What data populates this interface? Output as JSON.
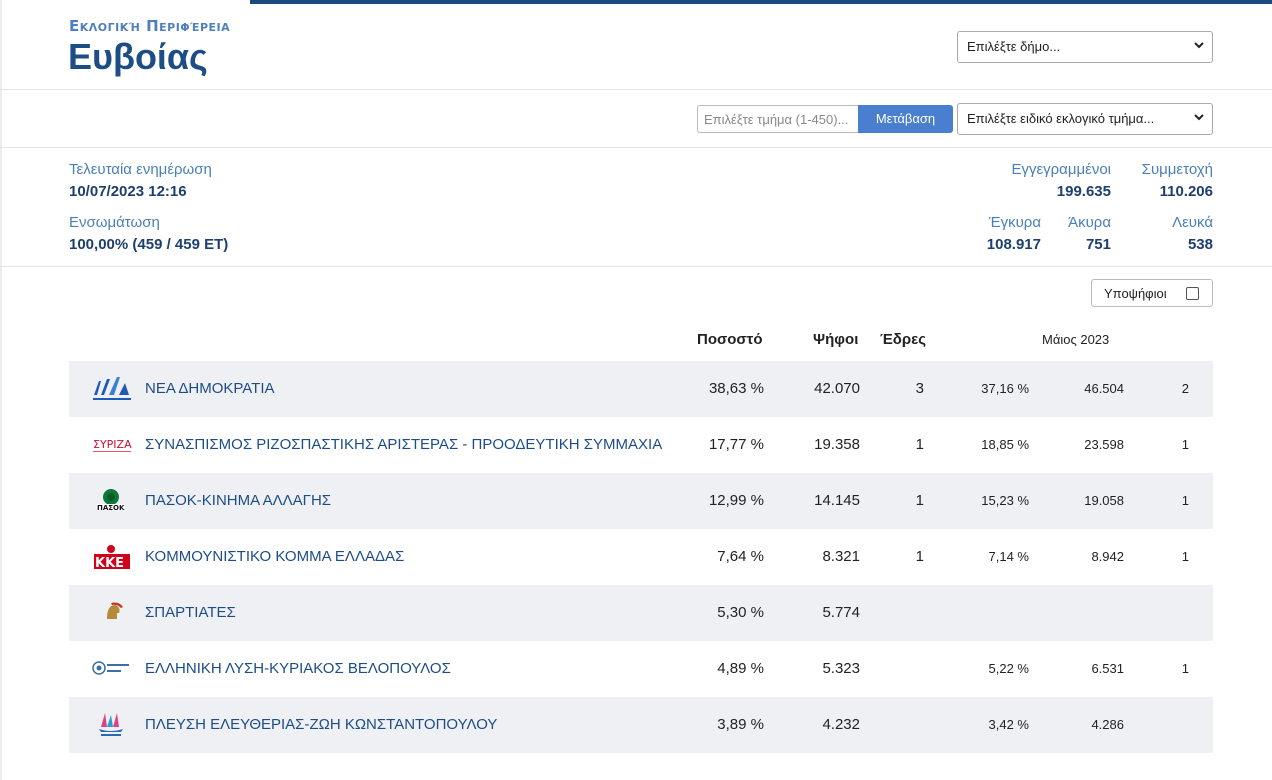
{
  "header": {
    "region_label": "Εκλογική Περιφέρεια",
    "region_name": "Ευβοίας",
    "municipality_select": "Επιλέξτε δήμο...",
    "section_input_placeholder": "Επιλέξτε τμήμα (1-450)...",
    "go_button": "Μετάβαση",
    "special_section_select": "Επιλέξτε ειδικό εκλογικό τμήμα..."
  },
  "stats": {
    "last_update_label": "Τελευταία ενημέρωση",
    "last_update_value": "10/07/2023 12:16",
    "integration_label": "Ενσωμάτωση",
    "integration_value": "100,00% (459 / 459 ΕΤ)",
    "registered_label": "Εγγεγραμμένοι",
    "registered_value": "199.635",
    "turnout_label": "Συμμετοχή",
    "turnout_value": "110.206",
    "valid_label": "Έγκυρα",
    "valid_value": "108.917",
    "invalid_label": "Άκυρα",
    "invalid_value": "751",
    "blank_label": "Λευκά",
    "blank_value": "538"
  },
  "candidates_toggle": "Υποψήφιοι",
  "table": {
    "headers": {
      "percent": "Ποσοστό",
      "votes": "Ψήφοι",
      "seats": "Έδρες",
      "prev": "Μάιος 2023"
    },
    "rows": [
      {
        "name": "ΝΕΑ ΔΗΜΟΚΡΑΤΙΑ",
        "logo": "nd-logo-icon",
        "pct": "38,63 %",
        "votes": "42.070",
        "seats": "3",
        "prev_pct": "37,16 %",
        "prev_votes": "46.504",
        "prev_seats": "2"
      },
      {
        "name": "ΣΥΝΑΣΠΙΣΜΟΣ ΡΙΖΟΣΠΑΣΤΙΚΗΣ ΑΡΙΣΤΕΡΑΣ - ΠΡΟΟΔΕΥΤΙΚΗ ΣΥΜΜΑΧΙΑ",
        "logo": "syriza-logo-icon",
        "pct": "17,77 %",
        "votes": "19.358",
        "seats": "1",
        "prev_pct": "18,85 %",
        "prev_votes": "23.598",
        "prev_seats": "1"
      },
      {
        "name": "ΠΑΣΟΚ-ΚΙΝΗΜΑ ΑΛΛΑΓΗΣ",
        "logo": "pasok-logo-icon",
        "pct": "12,99 %",
        "votes": "14.145",
        "seats": "1",
        "prev_pct": "15,23 %",
        "prev_votes": "19.058",
        "prev_seats": "1"
      },
      {
        "name": "ΚΟΜΜΟΥΝΙΣΤΙΚΟ ΚΟΜΜΑ ΕΛΛΑΔΑΣ",
        "logo": "kke-logo-icon",
        "pct": "7,64 %",
        "votes": "8.321",
        "seats": "1",
        "prev_pct": "7,14 %",
        "prev_votes": "8.942",
        "prev_seats": "1"
      },
      {
        "name": "ΣΠΑΡΤΙΑΤΕΣ",
        "logo": "spartiates-logo-icon",
        "pct": "5,30 %",
        "votes": "5.774",
        "seats": "",
        "prev_pct": "",
        "prev_votes": "",
        "prev_seats": ""
      },
      {
        "name": "ΕΛΛΗΝΙΚΗ ΛΥΣΗ-ΚΥΡΙΑΚΟΣ ΒΕΛΟΠΟΥΛΟΣ",
        "logo": "elliniki-lysi-logo-icon",
        "pct": "4,89 %",
        "votes": "5.323",
        "seats": "",
        "prev_pct": "5,22 %",
        "prev_votes": "6.531",
        "prev_seats": "1"
      },
      {
        "name": "ΠΛΕΥΣΗ ΕΛΕΥΘΕΡΙΑΣ-ΖΩΗ ΚΩΝΣΤΑΝΤΟΠΟΥΛΟΥ",
        "logo": "plefsi-logo-icon",
        "pct": "3,89 %",
        "votes": "4.232",
        "seats": "",
        "prev_pct": "3,42 %",
        "prev_votes": "4.286",
        "prev_seats": ""
      }
    ]
  },
  "colors": {
    "accent": "#4a7fd0",
    "title": "#1d4d86",
    "row_shade": "#eef0f3"
  }
}
